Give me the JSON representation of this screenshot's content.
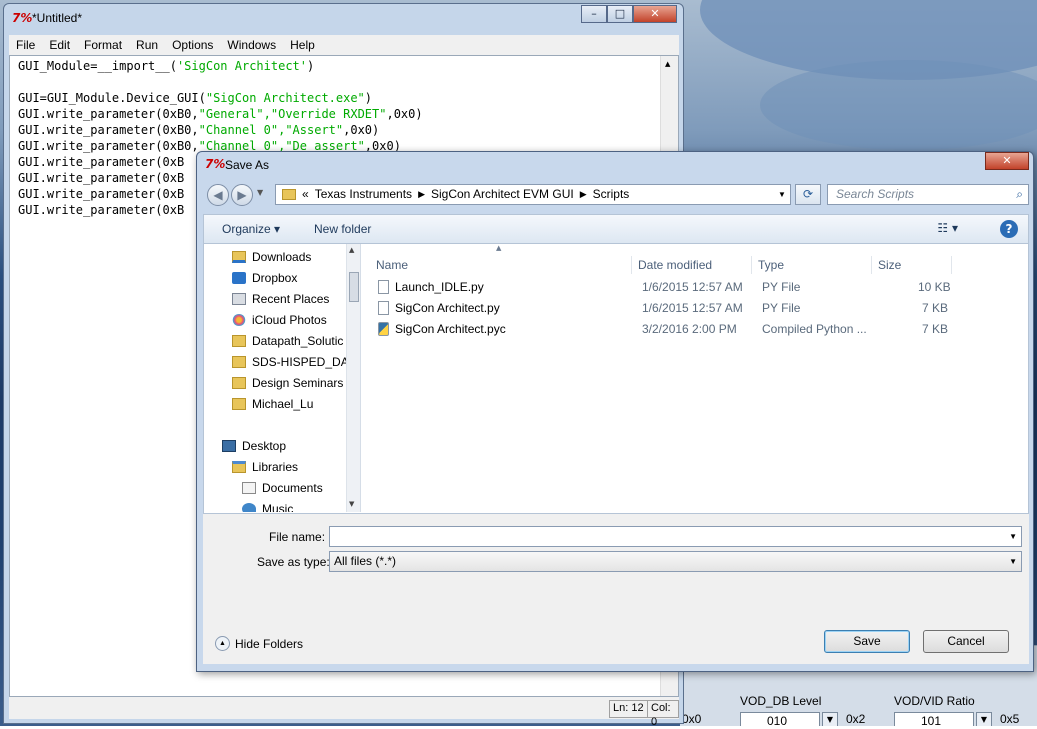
{
  "background": {
    "labels": {
      "vod_db_level": "VOD_DB Level",
      "vod_vid_ratio": "VOD/VID Ratio"
    },
    "values": {
      "vod_db_value": "010",
      "vod_db_hex": "0x2",
      "vod_vid_value": "101",
      "vod_vid_hex": "0x5",
      "left_hex": "0x0"
    }
  },
  "idle": {
    "title": "*Untitled*",
    "menu": [
      "File",
      "Edit",
      "Format",
      "Run",
      "Options",
      "Windows",
      "Help"
    ],
    "code": [
      {
        "a": "GUI_Module=__import__(",
        "s": "'SigCon Architect'",
        "b": ")"
      },
      {
        "a": "",
        "s": "",
        "b": ""
      },
      {
        "a": "GUI=GUI_Module.Device_GUI(",
        "s": "\"SigCon Architect.exe\"",
        "b": ")"
      },
      {
        "a": "GUI.write_parameter(0xB0,",
        "s": "\"General\",\"Override RXDET\"",
        "b": ",0x0)"
      },
      {
        "a": "GUI.write_parameter(0xB0,",
        "s": "\"Channel 0\",\"Assert\"",
        "b": ",0x0)"
      },
      {
        "a": "GUI.write_parameter(0xB0,",
        "s": "\"Channel 0\",\"De assert\"",
        "b": ",0x0)"
      },
      {
        "a": "GUI.write_parameter(0xB",
        "s": "",
        "b": ""
      },
      {
        "a": "GUI.write_parameter(0xB",
        "s": "",
        "b": ""
      },
      {
        "a": "GUI.write_parameter(0xB",
        "s": "",
        "b": ""
      },
      {
        "a": "GUI.write_parameter(0xB",
        "s": "",
        "b": ""
      }
    ],
    "status": {
      "line": "Ln: 12",
      "col": "Col: 0"
    }
  },
  "dialog": {
    "title": "Save As",
    "breadcrumb": {
      "prefix": "«",
      "items": [
        "Texas Instruments",
        "SigCon Architect EVM GUI",
        "Scripts"
      ]
    },
    "search_placeholder": "Search Scripts",
    "toolbar": {
      "organize": "Organize ▾",
      "new_folder": "New folder"
    },
    "nav": [
      {
        "label": "Downloads",
        "icon": "downloads-icon",
        "indent": 1
      },
      {
        "label": "Dropbox",
        "icon": "dropbox-icon",
        "indent": 1
      },
      {
        "label": "Recent Places",
        "icon": "recent-places-icon",
        "indent": 1
      },
      {
        "label": "iCloud Photos",
        "icon": "icloud-photos-icon",
        "indent": 1
      },
      {
        "label": "Datapath_Solutic",
        "icon": "folder-icon",
        "indent": 1
      },
      {
        "label": "SDS-HISPED_DAT",
        "icon": "folder-icon",
        "indent": 1
      },
      {
        "label": "Design Seminars",
        "icon": "folder-icon",
        "indent": 1
      },
      {
        "label": "Michael_Lu",
        "icon": "folder-icon",
        "indent": 1
      },
      {
        "label": "",
        "icon": "",
        "indent": 0
      },
      {
        "label": "Desktop",
        "icon": "desktop-icon",
        "indent": 0
      },
      {
        "label": "Libraries",
        "icon": "libraries-icon",
        "indent": 1
      },
      {
        "label": "Documents",
        "icon": "documents-icon",
        "indent": 2
      },
      {
        "label": "Music",
        "icon": "music-icon",
        "indent": 2
      }
    ],
    "columns": [
      "Name",
      "Date modified",
      "Type",
      "Size"
    ],
    "files": [
      {
        "name": "Launch_IDLE.py",
        "date": "1/6/2015 12:57 AM",
        "type": "PY File",
        "size": "10 KB",
        "pyc": false
      },
      {
        "name": "SigCon Architect.py",
        "date": "1/6/2015 12:57 AM",
        "type": "PY File",
        "size": "7 KB",
        "pyc": false
      },
      {
        "name": "SigCon Architect.pyc",
        "date": "3/2/2016 2:00 PM",
        "type": "Compiled Python ...",
        "size": "7 KB",
        "pyc": true
      }
    ],
    "file_name_label": "File name:",
    "file_name_value": "",
    "save_type_label": "Save as type:",
    "save_type_value": "All files (*.*)",
    "hide_folders": "Hide Folders",
    "save": "Save",
    "cancel": "Cancel"
  }
}
